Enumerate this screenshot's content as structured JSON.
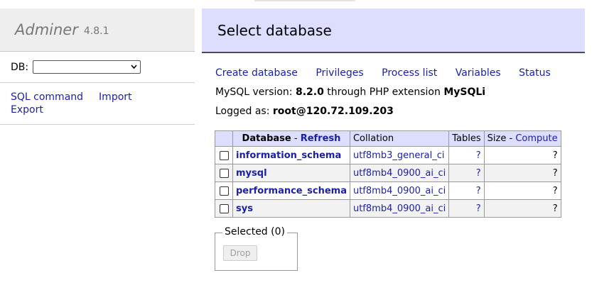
{
  "app": {
    "name": "Adminer",
    "version": "4.8.1"
  },
  "sidebar": {
    "db_label": "DB:",
    "db_value": "",
    "links": {
      "sql_command": "SQL command",
      "import": "Import",
      "export": "Export"
    }
  },
  "page": {
    "title": "Select database"
  },
  "top_links": [
    "Create database",
    "Privileges",
    "Process list",
    "Variables",
    "Status"
  ],
  "info": {
    "version_prefix": "MySQL version:",
    "version": "8.2.0",
    "through": "through PHP extension",
    "extension": "MySQLi",
    "logged_prefix": "Logged as:",
    "user": "root@120.72.109.203"
  },
  "table": {
    "headers": {
      "database": "Database",
      "sep": " - ",
      "refresh": "Refresh",
      "collation": "Collation",
      "tables": "Tables",
      "size": "Size",
      "compute": "Compute"
    },
    "rows": [
      {
        "name": "information_schema",
        "collation": "utf8mb3_general_ci",
        "tables": "?",
        "size": "?"
      },
      {
        "name": "mysql",
        "collation": "utf8mb4_0900_ai_ci",
        "tables": "?",
        "size": "?"
      },
      {
        "name": "performance_schema",
        "collation": "utf8mb4_0900_ai_ci",
        "tables": "?",
        "size": "?"
      },
      {
        "name": "sys",
        "collation": "utf8mb4_0900_ai_ci",
        "tables": "?",
        "size": "?"
      }
    ]
  },
  "selected": {
    "legend": "Selected (0)",
    "drop_label": "Drop"
  },
  "colors": {
    "link": "#1a1fa8",
    "header_bg": "#ddddff",
    "brand_bg": "#eeeeee"
  },
  "icons": {
    "select_arrow": "chevron-down-icon"
  }
}
